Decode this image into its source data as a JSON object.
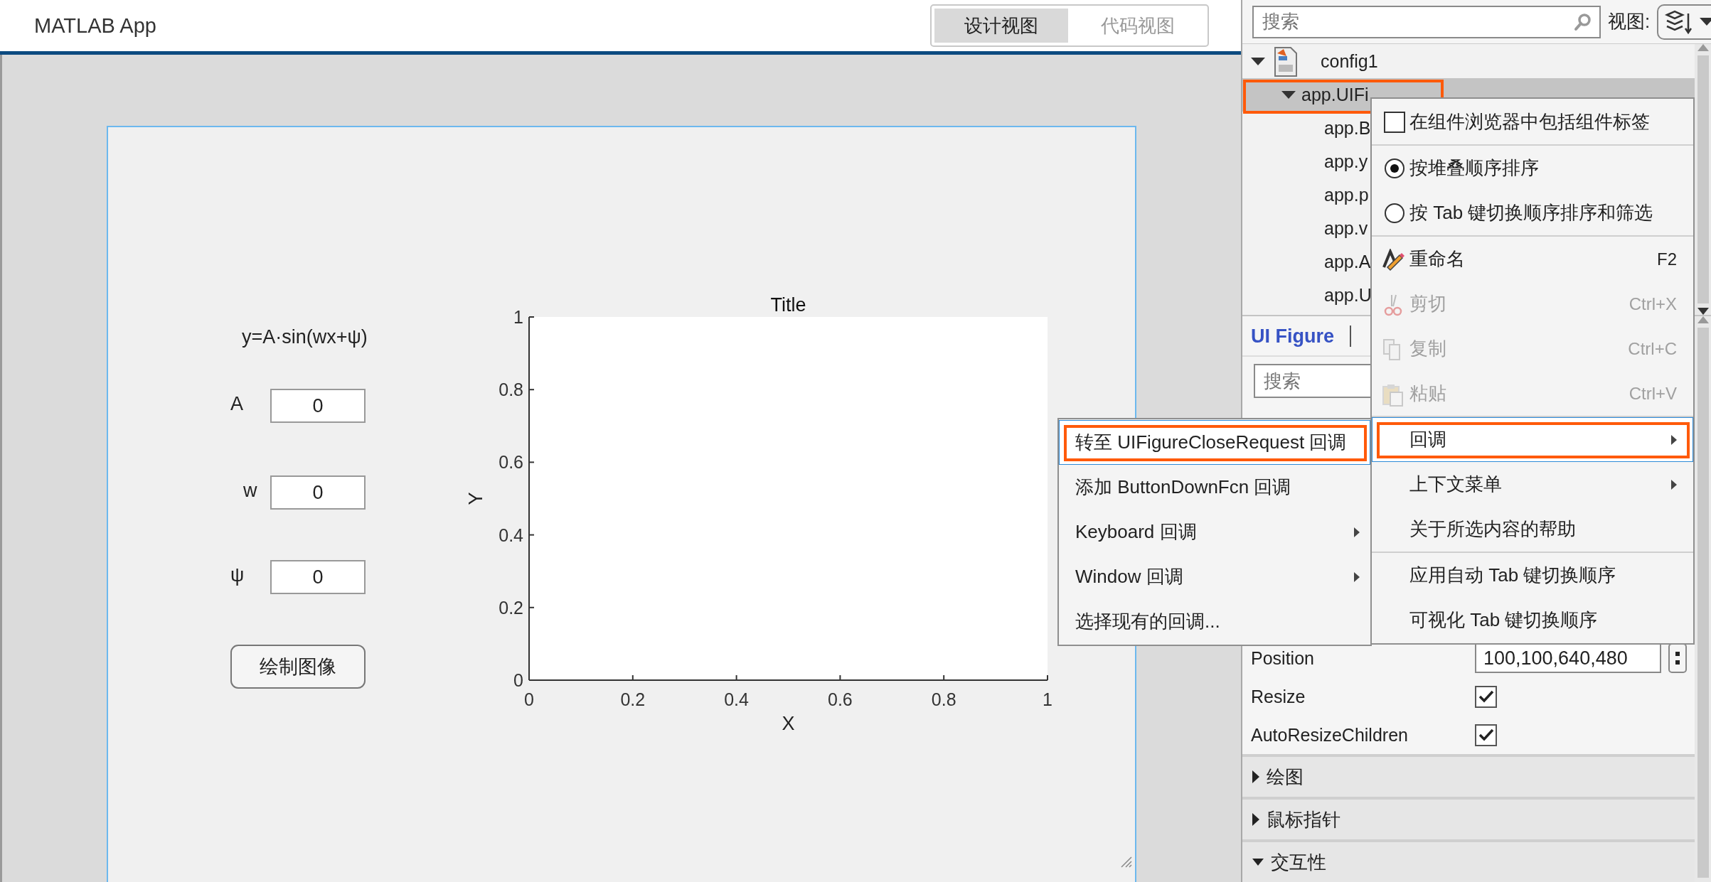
{
  "header": {
    "title": "MATLAB App",
    "view_toggle": [
      {
        "label": "设计视图",
        "selected": true
      },
      {
        "label": "代码视图",
        "selected": false
      }
    ]
  },
  "canvas": {
    "formula": "y=A·sin(wx+ψ)",
    "fields": [
      {
        "label": "A",
        "value": "0"
      },
      {
        "label": "w",
        "value": "0"
      },
      {
        "label": "ψ",
        "value": "0"
      }
    ],
    "button": "绘制图像",
    "axes": {
      "chart_data": {
        "type": "line",
        "title": "Title",
        "xlabel": "X",
        "ylabel": "Y",
        "xlim": [
          0,
          1
        ],
        "ylim": [
          0,
          1
        ],
        "xticks": [
          0,
          0.2,
          0.4,
          0.6,
          0.8,
          1
        ],
        "yticks": [
          0,
          0.2,
          0.4,
          0.6,
          0.8,
          1
        ]
      }
    }
  },
  "browser": {
    "search": {
      "placeholder": "搜索"
    },
    "view_label": "视图:",
    "tree": [
      {
        "label": "config1",
        "expanded": true,
        "selected": false,
        "outlined": false,
        "children": [
          {
            "label": "app.UIFi",
            "expanded": true,
            "selected": true,
            "outlined": true,
            "children": [
              {
                "label": "app.B",
                "selected": false,
                "outlined": false
              },
              {
                "label": "app.y",
                "selected": false,
                "outlined": false
              },
              {
                "label": "app.p",
                "selected": false,
                "outlined": false
              },
              {
                "label": "app.v",
                "selected": false,
                "outlined": false
              },
              {
                "label": "app.A",
                "selected": false,
                "outlined": false
              },
              {
                "label": "app.U",
                "selected": false,
                "outlined": false
              }
            ]
          }
        ]
      }
    ]
  },
  "inspector": {
    "tabs": [
      {
        "label": "UI Figure",
        "selected": true
      }
    ],
    "search": {
      "placeholder": "搜索"
    },
    "properties": [
      {
        "kind": "text",
        "name": "Position",
        "value": "100,100,640,480"
      },
      {
        "kind": "checkbox",
        "name": "Resize",
        "checked": true
      },
      {
        "kind": "checkbox",
        "name": "AutoResizeChildren",
        "checked": true
      }
    ],
    "sections": [
      {
        "label": "绘图",
        "expanded": false
      },
      {
        "label": "鼠标指针",
        "expanded": false
      },
      {
        "label": "交互性",
        "expanded": true
      }
    ]
  },
  "context_menu": {
    "groups": [
      [
        {
          "kind": "checkbox",
          "label": "在组件浏览器中包括组件标签",
          "checked": false
        }
      ],
      [
        {
          "kind": "radio",
          "label": "按堆叠顺序排序",
          "selected": true
        },
        {
          "kind": "radio",
          "label": "按 Tab 键切换顺序排序和筛选",
          "selected": false
        }
      ],
      [
        {
          "kind": "command",
          "label": "重命名",
          "shortcut": "F2",
          "disabled": false,
          "highlighted": false,
          "outlined": false,
          "submenu": false
        },
        {
          "kind": "command",
          "label": "剪切",
          "shortcut": "Ctrl+X",
          "disabled": true,
          "highlighted": false,
          "outlined": false,
          "submenu": false
        },
        {
          "kind": "command",
          "label": "复制",
          "shortcut": "Ctrl+C",
          "disabled": true,
          "highlighted": false,
          "outlined": false,
          "submenu": false
        },
        {
          "kind": "command",
          "label": "粘贴",
          "shortcut": "Ctrl+V",
          "disabled": true,
          "highlighted": false,
          "outlined": false,
          "submenu": false
        }
      ],
      [
        {
          "kind": "command",
          "label": "回调",
          "disabled": false,
          "highlighted": true,
          "outlined": true,
          "submenu": true
        },
        {
          "kind": "command",
          "label": "上下文菜单",
          "disabled": false,
          "highlighted": false,
          "outlined": false,
          "submenu": true
        },
        {
          "kind": "command",
          "label": "关于所选内容的帮助",
          "disabled": false,
          "highlighted": false,
          "outlined": false,
          "submenu": false
        }
      ],
      [
        {
          "kind": "command",
          "label": "应用自动 Tab 键切换顺序",
          "disabled": false,
          "highlighted": false,
          "outlined": false,
          "submenu": false
        },
        {
          "kind": "command",
          "label": "可视化 Tab 键切换顺序",
          "disabled": false,
          "highlighted": false,
          "outlined": false,
          "submenu": false
        }
      ]
    ]
  },
  "submenu": {
    "groups": [
      [
        {
          "kind": "command",
          "label": "转至 UIFigureCloseRequest 回调",
          "disabled": false,
          "highlighted": true,
          "outlined": true,
          "submenu": false
        },
        {
          "kind": "command",
          "label": "添加 ButtonDownFcn 回调",
          "disabled": false,
          "highlighted": false,
          "outlined": false,
          "submenu": false
        },
        {
          "kind": "command",
          "label": "Keyboard 回调",
          "disabled": false,
          "highlighted": false,
          "outlined": false,
          "submenu": true
        },
        {
          "kind": "command",
          "label": "Window 回调",
          "disabled": false,
          "highlighted": false,
          "outlined": false,
          "submenu": true
        },
        {
          "kind": "command",
          "label": "选择现有的回调...",
          "disabled": false,
          "highlighted": false,
          "outlined": false,
          "submenu": false
        }
      ]
    ]
  }
}
